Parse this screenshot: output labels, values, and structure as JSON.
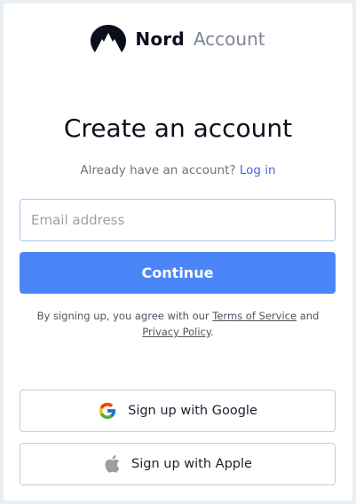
{
  "brand": {
    "name": "Nord",
    "product": "Account"
  },
  "heading": "Create an account",
  "signin": {
    "prompt": "Already have an account?",
    "link": "Log in"
  },
  "email": {
    "placeholder": "Email address",
    "value": ""
  },
  "continue_label": "Continue",
  "terms": {
    "prefix": "By signing up, you agree with our",
    "tos": "Terms of Service",
    "and": "and",
    "privacy": "Privacy Policy",
    "suffix": "."
  },
  "social": {
    "google_label": "Sign up with Google",
    "apple_label": "Sign up with Apple"
  },
  "colors": {
    "primary": "#4b86f8",
    "link": "#3e6fe0",
    "field_border": "#9ec4f3"
  },
  "icons": [
    "nord-mountain-logo-icon",
    "google-g-icon",
    "apple-icon"
  ]
}
